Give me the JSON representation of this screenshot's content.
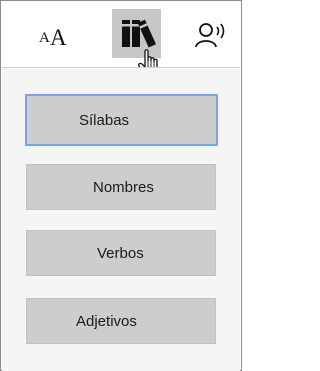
{
  "toolbar": {
    "text_size_icon": "text-size-icon",
    "parts_of_speech_icon": "books-icon",
    "read_aloud_icon": "read-aloud-icon"
  },
  "options": [
    {
      "label": "Sílabas",
      "selected": true
    },
    {
      "label": "Nombres",
      "selected": false
    },
    {
      "label": "Verbos",
      "selected": false
    },
    {
      "label": "Adjetivos",
      "selected": false
    }
  ],
  "colors": {
    "selected_tool_bg": "#c7c7c7",
    "option_bg": "#cdcdcd",
    "selected_border": "#78a6e0",
    "panel_bg": "#f5f5f5"
  }
}
